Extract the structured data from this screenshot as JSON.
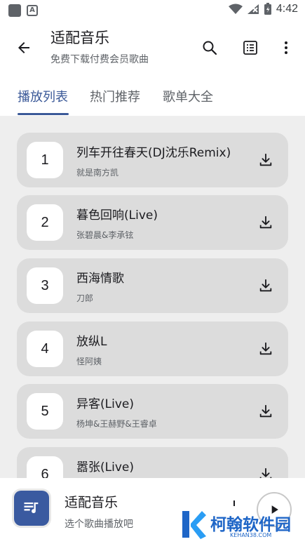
{
  "status": {
    "time": "4:42"
  },
  "appbar": {
    "title": "适配音乐",
    "subtitle": "免费下载付费会员歌曲"
  },
  "tabs": [
    {
      "label": "播放列表",
      "active": true
    },
    {
      "label": "热门推荐",
      "active": false
    },
    {
      "label": "歌单大全",
      "active": false
    }
  ],
  "songs": [
    {
      "index": "1",
      "title": "列车开往春天(DJ沈乐Remix)",
      "artist": "就是南方凯"
    },
    {
      "index": "2",
      "title": "暮色回响(Live)",
      "artist": "张碧晨&李承铉"
    },
    {
      "index": "3",
      "title": "西海情歌",
      "artist": "刀郎"
    },
    {
      "index": "4",
      "title": "放纵L",
      "artist": "怪阿姨"
    },
    {
      "index": "5",
      "title": "异客(Live)",
      "artist": "杨坤&王赫野&王睿卓"
    },
    {
      "index": "6",
      "title": "嚣张(Live)",
      "artist": ""
    }
  ],
  "player": {
    "title": "适配音乐",
    "subtitle": "选个歌曲播放吧"
  },
  "watermark": {
    "brand": "柯翰软件园",
    "domain": "KEHAN38.COM"
  },
  "colors": {
    "accent": "#3b5998",
    "card": "#dcdcdc",
    "list_bg": "#eeeeee"
  }
}
